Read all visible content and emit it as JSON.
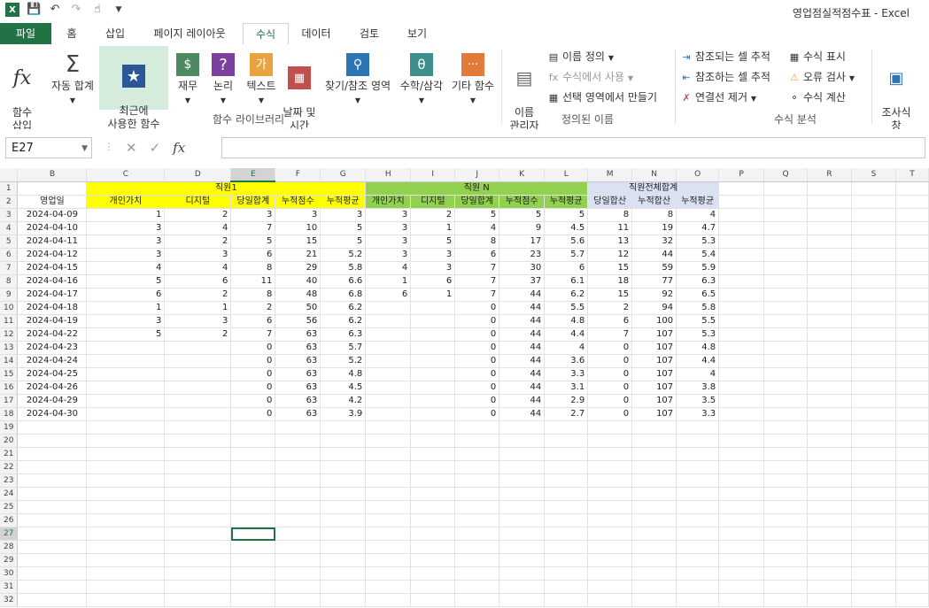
{
  "titlebar": {
    "logo": "X",
    "title": "영업점실적점수표 - Excel"
  },
  "tabs": [
    "파일",
    "홈",
    "삽입",
    "페이지 레이아웃",
    "수식",
    "데이터",
    "검토",
    "보기"
  ],
  "ribbon": {
    "insert_function": "함수\n삽입",
    "autosum": "자동 합계",
    "recent": "최근에\n사용한 함수",
    "financial": "재무",
    "logical": "논리",
    "text": "텍스트",
    "datetime": "날짜 및\n시간",
    "lookup": "찾기/참조 영역",
    "math": "수학/삼각",
    "more": "기타 함수",
    "library_label": "함수 라이브러리",
    "name_manager": "이름\n관리자",
    "define_name": "이름 정의",
    "use_in_formula": "수식에서 사용",
    "create_from_selection": "선택 영역에서 만들기",
    "defined_names_label": "정의된 이름",
    "trace_precedents": "참조되는 셀 추적",
    "trace_dependents": "참조하는 셀 추적",
    "remove_arrows": "연결선 제거",
    "show_formulas": "수식 표시",
    "error_checking": "오류 검사",
    "evaluate_formula": "수식 계산",
    "auditing_label": "수식 분석",
    "watch_window": "조사식\n창"
  },
  "formula_bar": {
    "name_box": "E27",
    "fx": "fx",
    "value": ""
  },
  "sheet": {
    "active_cell": "E27",
    "columns": [
      "B",
      "C",
      "D",
      "E",
      "F",
      "G",
      "H",
      "I",
      "J",
      "K",
      "L",
      "M",
      "N",
      "O",
      "P",
      "Q",
      "R",
      "S",
      "T"
    ],
    "row1": {
      "emp1": "직원1",
      "empN": "직원 N",
      "total": "직원전체합계"
    },
    "row2": [
      "영업일",
      "개인가치",
      "디지털",
      "당일합계",
      "누적점수",
      "누적평균",
      "개인가치",
      "디지털",
      "당일합계",
      "누적점수",
      "누적평균",
      "당일합산",
      "누적합산",
      "누적평균"
    ],
    "data": [
      [
        "2024-04-09",
        "1",
        "2",
        "3",
        "3",
        "3",
        "3",
        "2",
        "5",
        "5",
        "5",
        "8",
        "8",
        "4"
      ],
      [
        "2024-04-10",
        "3",
        "4",
        "7",
        "10",
        "5",
        "3",
        "1",
        "4",
        "9",
        "4.5",
        "11",
        "19",
        "4.7"
      ],
      [
        "2024-04-11",
        "3",
        "2",
        "5",
        "15",
        "5",
        "3",
        "5",
        "8",
        "17",
        "5.6",
        "13",
        "32",
        "5.3"
      ],
      [
        "2024-04-12",
        "3",
        "3",
        "6",
        "21",
        "5.2",
        "3",
        "3",
        "6",
        "23",
        "5.7",
        "12",
        "44",
        "5.4"
      ],
      [
        "2024-04-15",
        "4",
        "4",
        "8",
        "29",
        "5.8",
        "4",
        "3",
        "7",
        "30",
        "6",
        "15",
        "59",
        "5.9"
      ],
      [
        "2024-04-16",
        "5",
        "6",
        "11",
        "40",
        "6.6",
        "1",
        "6",
        "7",
        "37",
        "6.1",
        "18",
        "77",
        "6.3"
      ],
      [
        "2024-04-17",
        "6",
        "2",
        "8",
        "48",
        "6.8",
        "6",
        "1",
        "7",
        "44",
        "6.2",
        "15",
        "92",
        "6.5"
      ],
      [
        "2024-04-18",
        "1",
        "1",
        "2",
        "50",
        "6.2",
        "",
        "",
        "0",
        "44",
        "5.5",
        "2",
        "94",
        "5.8"
      ],
      [
        "2024-04-19",
        "3",
        "3",
        "6",
        "56",
        "6.2",
        "",
        "",
        "0",
        "44",
        "4.8",
        "6",
        "100",
        "5.5"
      ],
      [
        "2024-04-22",
        "5",
        "2",
        "7",
        "63",
        "6.3",
        "",
        "",
        "0",
        "44",
        "4.4",
        "7",
        "107",
        "5.3"
      ],
      [
        "2024-04-23",
        "",
        "",
        "0",
        "63",
        "5.7",
        "",
        "",
        "0",
        "44",
        "4",
        "0",
        "107",
        "4.8"
      ],
      [
        "2024-04-24",
        "",
        "",
        "0",
        "63",
        "5.2",
        "",
        "",
        "0",
        "44",
        "3.6",
        "0",
        "107",
        "4.4"
      ],
      [
        "2024-04-25",
        "",
        "",
        "0",
        "63",
        "4.8",
        "",
        "",
        "0",
        "44",
        "3.3",
        "0",
        "107",
        "4"
      ],
      [
        "2024-04-26",
        "",
        "",
        "0",
        "63",
        "4.5",
        "",
        "",
        "0",
        "44",
        "3.1",
        "0",
        "107",
        "3.8"
      ],
      [
        "2024-04-29",
        "",
        "",
        "0",
        "63",
        "4.2",
        "",
        "",
        "0",
        "44",
        "2.9",
        "0",
        "107",
        "3.5"
      ],
      [
        "2024-04-30",
        "",
        "",
        "0",
        "63",
        "3.9",
        "",
        "",
        "0",
        "44",
        "2.7",
        "0",
        "107",
        "3.3"
      ]
    ],
    "row_count": 32
  }
}
